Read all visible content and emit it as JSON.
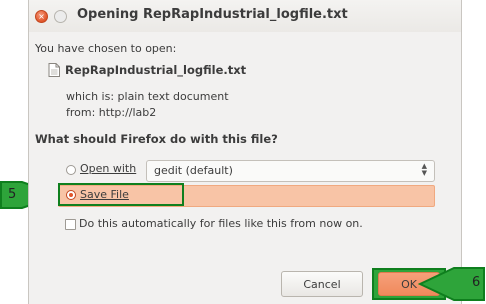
{
  "window": {
    "title": "Opening RepRapIndustrial_logfile.txt"
  },
  "intro": "You have chosen to open:",
  "file": {
    "name": "RepRapIndustrial_logfile.txt",
    "type_line": "which is: plain text document",
    "from_line": "from: http://lab2"
  },
  "question": "What should Firefox do with this file?",
  "options": {
    "open_with": {
      "label": "Open with",
      "selected": false,
      "app": "gedit (default)"
    },
    "save_file": {
      "label": "Save File",
      "selected": true
    },
    "auto": {
      "label": "Do this automatically for files like this from now on.",
      "checked": false
    }
  },
  "buttons": {
    "cancel": "Cancel",
    "ok": "OK"
  },
  "annotations": {
    "step5": "5",
    "step6": "6"
  },
  "colors": {
    "highlight": "#f8c4a6",
    "callout_green": "#2ea43a",
    "outline_green": "#0f7f1e",
    "ok_orange": "#f08a5c"
  }
}
